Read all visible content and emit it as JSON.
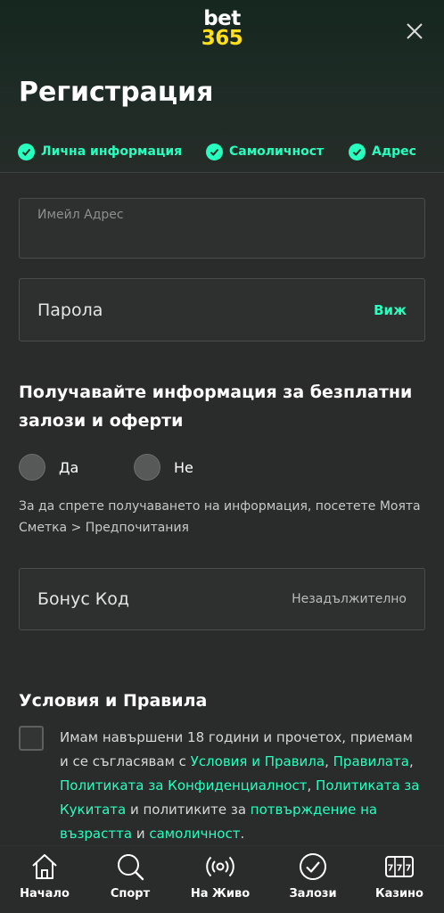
{
  "logo": {
    "line1": "bet",
    "line2": "365"
  },
  "header": {
    "title": "Регистрация"
  },
  "steps": [
    {
      "label": "Лична информация"
    },
    {
      "label": "Самоличност"
    },
    {
      "label": "Адрес"
    }
  ],
  "form": {
    "email_placeholder": "Имейл Адрес",
    "password_placeholder": "Парола",
    "password_toggle": "Виж",
    "marketing_heading": "Получавайте информация за безплатни залози и оферти",
    "radio_yes": "Да",
    "radio_no": "Не",
    "marketing_info": "За да спрете получаването на информация, посетете Моята Сметка > Предпочитания",
    "bonus_placeholder": "Бонус Код",
    "bonus_note": "Незадължително",
    "terms_heading": "Условия и Правила",
    "terms": {
      "t1": "Имам навършени 18 години и прочетох, приемам и се съгласявам с ",
      "l1": "Условия и Правила",
      "t2": ", ",
      "l2": "Правилата",
      "t3": ", ",
      "l3": "Политиката за Конфиденциалност",
      "t4": ", ",
      "l4": "Политиката за Кукитата",
      "t5": " и политиките за ",
      "l5": "потвърждение на възрастта",
      "t6": " и ",
      "l6": "самоличност",
      "t7": "."
    }
  },
  "nav": [
    {
      "label": "Начало",
      "icon": "home-icon"
    },
    {
      "label": "Спорт",
      "icon": "search-icon"
    },
    {
      "label": "На Живо",
      "icon": "live-icon"
    },
    {
      "label": "Залози",
      "icon": "bets-icon"
    },
    {
      "label": "Казино",
      "icon": "casino-icon"
    }
  ],
  "colors": {
    "accent": "#26ffbe",
    "logo_yellow": "#ffdf1b",
    "background": "#2a2b2b"
  }
}
